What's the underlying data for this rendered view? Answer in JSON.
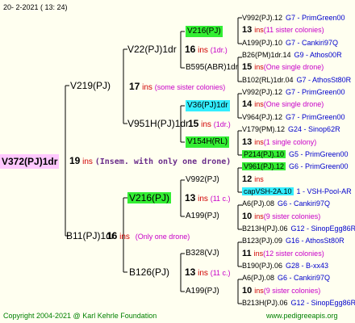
{
  "header": {
    "date": "20-  2-2021  ( 13: 24)"
  },
  "root": {
    "label": "V372(PJ)1dr",
    "ins_num": "19",
    "ins_word": "ins",
    "note": "(Insem. with only one drone)"
  },
  "father_a": {
    "label": "V219(PJ)",
    "ins_num": "17",
    "ins_word": "ins",
    "note": "(some sister colonies)"
  },
  "father_b": {
    "label": "B11(PJ)1dr",
    "ins_num": "16",
    "ins_word": "ins",
    "note": "(Only one drone)"
  },
  "gf1": {
    "label": "V22(PJ)1dr",
    "ins_num": "16",
    "ins_word": "ins",
    "note": "(1dr.)"
  },
  "gf2": {
    "label": "V951H(PJ)1dr",
    "ins_num": "15",
    "ins_word": "ins",
    "note": "(1dr.)"
  },
  "gf3": {
    "label": "V216(PJ)",
    "ins_num": "13",
    "ins_word": "ins",
    "note": "(11 c.)"
  },
  "gf4": {
    "label": "B126(PJ)",
    "ins_num": "13",
    "ins_word": "ins",
    "note": "(11 c.)"
  },
  "l3": [
    {
      "label": "V216(PJ)"
    },
    {
      "label": "B595(ABR)1dr"
    },
    {
      "label": "V36(PJ)1dr"
    },
    {
      "label": "V154H(RL)"
    },
    {
      "label": "V992(PJ)"
    },
    {
      "label": "A199(PJ)"
    },
    {
      "label": "B328(VJ)"
    },
    {
      "label": "A199(PJ)"
    }
  ],
  "l4": [
    {
      "name": "V992(PJ).12",
      "src": "G7 - PrimGreen00"
    },
    {
      "num": "13",
      "ins": "ins",
      "note": "(11 sister colonies)"
    },
    {
      "name": "A199(PJ).10",
      "src": "G7 - Cankiri97Q"
    },
    {
      "name": "B26(PM)1dr.14",
      "src": "G9 - Athos00R"
    },
    {
      "num": "15",
      "ins": "ins",
      "note": "(One single drone)"
    },
    {
      "name": "B102(RL)1dr.04",
      "src": "G7 - AthosSt80R"
    },
    {
      "name": "V992(PJ).12",
      "src": "G7 - PrimGreen00"
    },
    {
      "num": "14",
      "ins": "ins",
      "note": "(One single drone)"
    },
    {
      "name": "V964(PJ).12",
      "src": "G7 - PrimGreen00"
    },
    {
      "name": "V179(PM).12",
      "src": "G24 - Sinop62R"
    },
    {
      "num": "13",
      "ins": "ins",
      "note": "(1 single colony)"
    },
    {
      "name": "P214(PJ).10",
      "src": "G5 - PrimGreen00"
    },
    {
      "name": "V961(PJ).12",
      "src": "G6 - PrimGreen00"
    },
    {
      "num": "12",
      "ins": "ins",
      "note": ""
    },
    {
      "name": "capVSH-2A.10",
      "src": "1 - VSH-Pool-AR"
    },
    {
      "name": "A6(PJ).08",
      "src": "G6 - Cankiri97Q"
    },
    {
      "num": "10",
      "ins": "ins",
      "note": "(9 sister colonies)"
    },
    {
      "name": "B213H(PJ).06",
      "src": "G12 - SinopEgg86R"
    },
    {
      "name": "B123(PJ).09",
      "src": "G16 - AthosSt80R"
    },
    {
      "num": "11",
      "ins": "ins",
      "note": "(12 sister colonies)"
    },
    {
      "name": "B190(PJ).06",
      "src": "G28 - B-xx43"
    },
    {
      "name": "A6(PJ).08",
      "src": "G6 - Cankiri97Q"
    },
    {
      "num": "10",
      "ins": "ins",
      "note": "(9 sister colonies)"
    },
    {
      "name": "B213H(PJ).06",
      "src": "G12 - SinopEgg86R"
    }
  ],
  "footer": {
    "copyright": "Copyright 2004-2021 @ Karl Kehrle Foundation",
    "site": "www.pedigreeapis.org"
  },
  "colors": {
    "background": "#fffff0",
    "root_bg": "#ffc8ff",
    "green_bg": "#33ee33",
    "cyan_bg": "#33eeff",
    "ins_red": "#d00000",
    "note_pink": "#c800c8",
    "source_blue": "#0000cc",
    "line": "#000000"
  }
}
